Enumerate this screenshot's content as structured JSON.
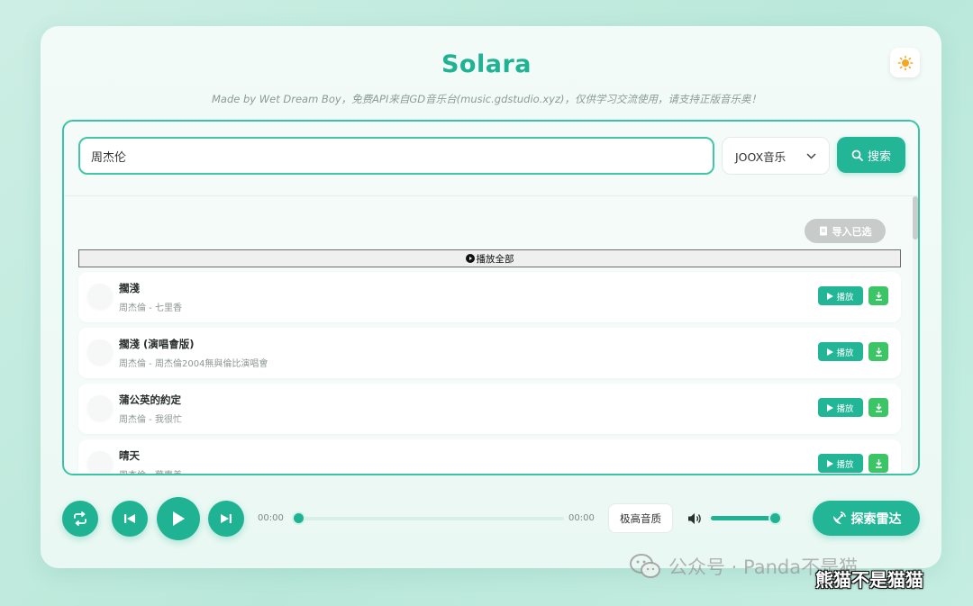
{
  "app": {
    "title": "Solara",
    "subtitle": "Made by Wet Dream Boy，免费API来自GD音乐台(music.gdstudio.xyz)，仅供学习交流使用，请支持正版音乐奥！"
  },
  "theme_toggle": {
    "icon": "sun-icon"
  },
  "search": {
    "value": "周杰伦",
    "source": "JOOX音乐",
    "button_label": "搜索"
  },
  "results": {
    "import_label": "导入已选",
    "play_all_label": "播放全部",
    "play_label": "播放",
    "songs": [
      {
        "title": "擱淺",
        "meta": "周杰倫 - 七里香"
      },
      {
        "title": "擱淺 (演唱會版)",
        "meta": "周杰倫 - 周杰倫2004無與倫比演唱會"
      },
      {
        "title": "蒲公英的約定",
        "meta": "周杰倫 - 我很忙"
      },
      {
        "title": "晴天",
        "meta": "周杰倫 - 葉惠美"
      }
    ]
  },
  "player": {
    "time_current": "00:00",
    "time_total": "00:00",
    "progress": 0,
    "quality_label": "极高音质",
    "volume": 1.0,
    "radar_label": "探索雷达"
  },
  "watermark": {
    "line1": "公众号 · Panda不是猫",
    "line2": "熊猫不是猫猫"
  },
  "colors": {
    "accent": "#1fb394",
    "download": "#3cc566",
    "disabled": "#c7cbca"
  }
}
